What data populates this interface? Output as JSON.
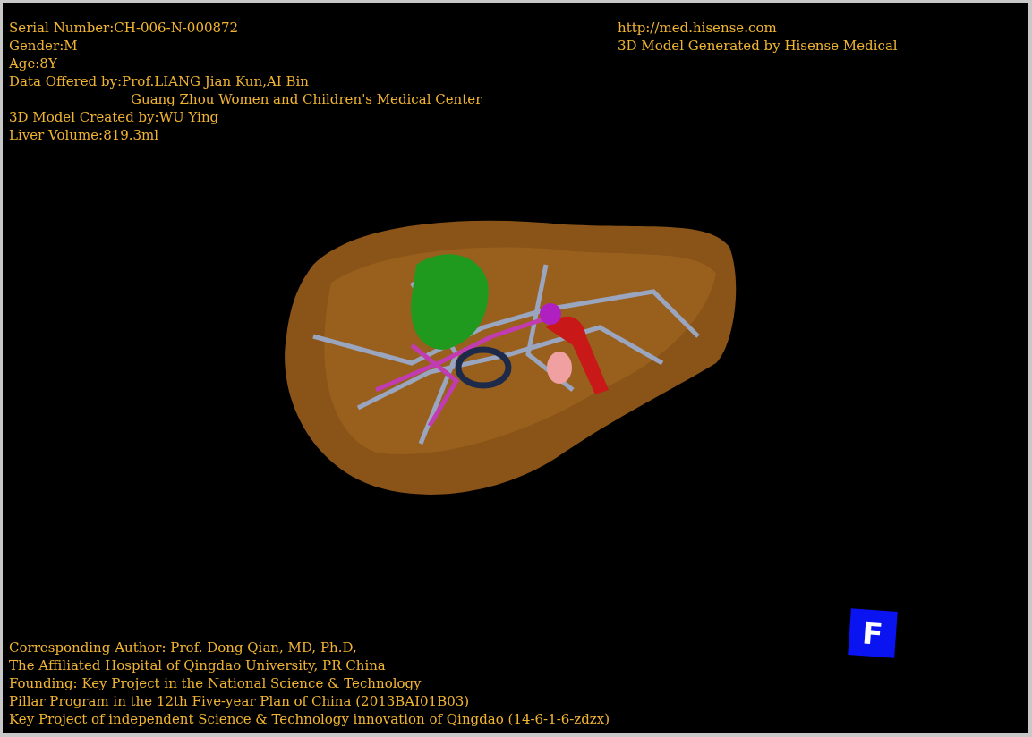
{
  "patient_info": [
    {
      "text": "Serial Number:CH-006-N-000872",
      "indented": false
    },
    {
      "text": "Gender:M",
      "indented": false
    },
    {
      "text": "Age:8Y",
      "indented": false
    },
    {
      "text": "Data Offered by:Prof.LIANG Jian Kun,AI Bin",
      "indented": false
    },
    {
      "text": "Guang Zhou Women and Children's Medical Center",
      "indented": true
    },
    {
      "text": "3D Model Created by:WU Ying",
      "indented": false
    },
    {
      "text": "Liver Volume:819.3ml",
      "indented": false
    }
  ],
  "vendor_info": [
    "http://med.hisense.com",
    "3D Model Generated by Hisense Medical"
  ],
  "model_view": {
    "kind": "liver"
  },
  "credits": [
    "Corresponding Author: Prof. Dong Qian, MD, Ph.D,",
    "The Affiliated Hospital of Qingdao University, PR China",
    "Founding: Key Project in the National Science & Technology",
    "Pillar Program in the 12th Five-year Plan of China (2013BAI01B03)",
    "Key Project of independent Science & Technology innovation of Qingdao (14-6-1-6-zdzx)"
  ],
  "orientation_marker": {
    "label": "F"
  }
}
